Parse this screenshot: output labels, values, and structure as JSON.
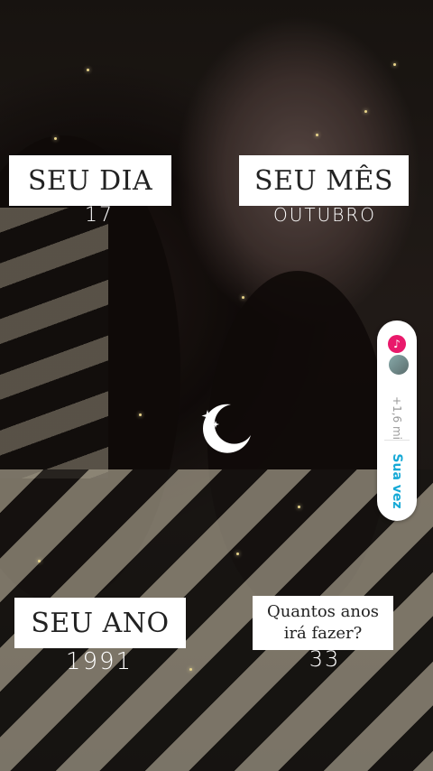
{
  "story": {
    "day": {
      "label": "SEU DIA",
      "value": "17"
    },
    "month": {
      "label": "SEU MÊS",
      "value": "OUTUBRO"
    },
    "year": {
      "label": "SEU ANO",
      "value": "1991"
    },
    "age": {
      "question": "Quantos anos irá fazer?",
      "answer": "33"
    },
    "sticker": {
      "icon": "moon-stars-icon"
    }
  },
  "add_yours": {
    "music_icon": "music-note-icon",
    "count": "+1,6 mi",
    "action_label": "Sua vez",
    "accent": "#16a9d6",
    "music_color": "#e9196b"
  }
}
